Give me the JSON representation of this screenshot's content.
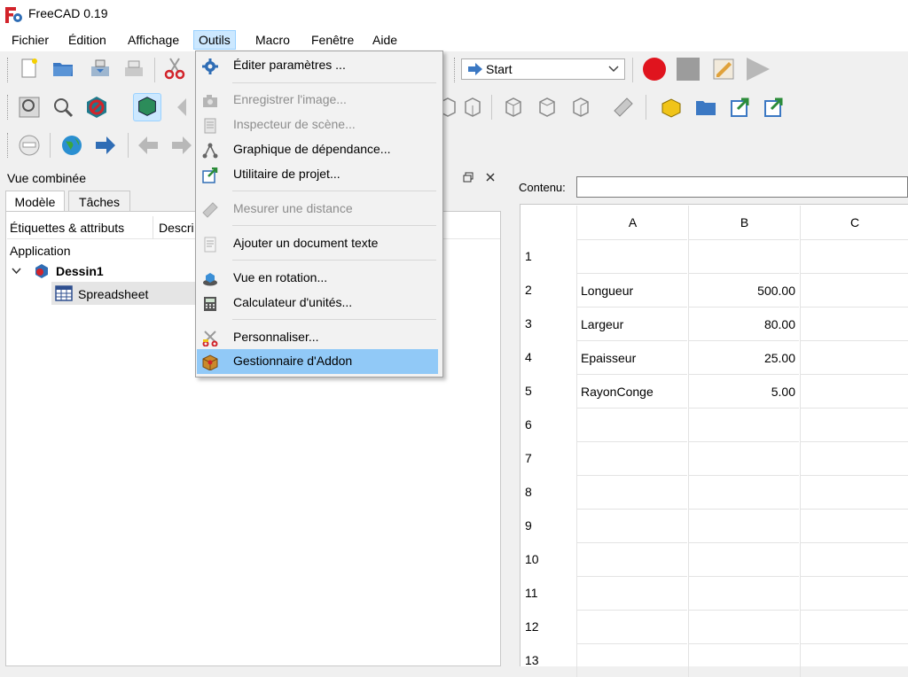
{
  "window": {
    "title": "FreeCAD 0.19"
  },
  "menubar": [
    "Fichier",
    "Édition",
    "Affichage",
    "Outils",
    "Macro",
    "Fenêtre",
    "Aide"
  ],
  "toolbar": {
    "macro_combo_value": "Start"
  },
  "combo_view": {
    "title": "Vue combinée",
    "tabs": [
      "Modèle",
      "Tâches"
    ],
    "tree_headers": [
      "Étiquettes & attributs",
      "Descri"
    ],
    "tree": {
      "root": "Application",
      "document": "Dessin1",
      "object": "Spreadsheet"
    }
  },
  "tools_menu": {
    "items": [
      {
        "label": "Éditer paramètres ...",
        "icon": "gear-icon",
        "enabled": true
      },
      {
        "label": "Enregistrer l'image...",
        "icon": "camera-icon",
        "enabled": false
      },
      {
        "label": "Inspecteur de scène...",
        "icon": "inspector-icon",
        "enabled": false
      },
      {
        "label": "Graphique de dépendance...",
        "icon": "dependency-graph-icon",
        "enabled": true
      },
      {
        "label": "Utilitaire de projet...",
        "icon": "project-utility-icon",
        "enabled": true
      },
      {
        "label": "Mesurer une distance",
        "icon": "ruler-icon",
        "enabled": false
      },
      {
        "label": "Ajouter un document texte",
        "icon": "text-document-icon",
        "enabled": true
      },
      {
        "label": "Vue en rotation...",
        "icon": "turntable-icon",
        "enabled": true
      },
      {
        "label": "Calculateur d'unités...",
        "icon": "calculator-icon",
        "enabled": true
      },
      {
        "label": "Personnaliser...",
        "icon": "customize-icon",
        "enabled": true
      },
      {
        "label": "Gestionnaire d'Addon",
        "icon": "addon-manager-icon",
        "enabled": true,
        "highlighted": true
      }
    ]
  },
  "spreadsheet": {
    "contenu_label": "Contenu:",
    "contenu_value": "",
    "columns": [
      "A",
      "B",
      "C"
    ],
    "rows": [
      {
        "num": "1",
        "A": "",
        "B": ""
      },
      {
        "num": "2",
        "A": "Longueur",
        "B": "500.00"
      },
      {
        "num": "3",
        "A": "Largeur",
        "B": "80.00"
      },
      {
        "num": "4",
        "A": "Epaisseur",
        "B": "25.00"
      },
      {
        "num": "5",
        "A": "RayonConge",
        "B": "5.00"
      },
      {
        "num": "6",
        "A": "",
        "B": ""
      },
      {
        "num": "7",
        "A": "",
        "B": ""
      },
      {
        "num": "8",
        "A": "",
        "B": ""
      },
      {
        "num": "9",
        "A": "",
        "B": ""
      },
      {
        "num": "10",
        "A": "",
        "B": ""
      },
      {
        "num": "11",
        "A": "",
        "B": ""
      },
      {
        "num": "12",
        "A": "",
        "B": ""
      },
      {
        "num": "13",
        "A": "",
        "B": ""
      }
    ]
  },
  "colors": {
    "menu_highlight": "#91c9f7",
    "active_menu": "#cce8ff",
    "record_button": "#e0141e"
  }
}
